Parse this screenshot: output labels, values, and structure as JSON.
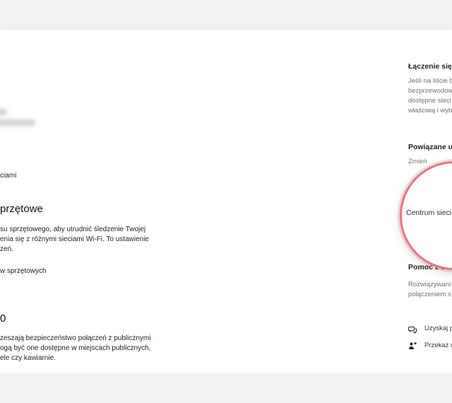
{
  "left": {
    "link_fragment": "ciami",
    "hardware_heading": "przętowe",
    "hardware_desc": "su sprzętowego, aby utrudnić śledzenie Twojej\nenia się z różnymi sieciami Wi-Fi. To ustawienie\nzeń.",
    "hardware_toggle_label": "w sprzętowych",
    "zero_heading": "0",
    "security_desc": "zeszają bezpieczeństwo połączeń z publicznymi\nogą być one dostępne w miejscach publicznych,\nele czy kawiarnie."
  },
  "right": {
    "connect_heading": "Łączenie się z",
    "connect_desc": "Jeśli na liście b\nbezprzewodow\ndostępne sieci\nwłaściwą i wyb",
    "related_heading": "Powiązane ust",
    "change_link": "Zmień",
    "network_center_link": "Centrum sieci",
    "help_heading": "Pomoc z sieci",
    "help_desc": "Rozwiązywani\npołączeniem s",
    "get_help": "Uzyskaj p",
    "feedback": "Przekaż o"
  },
  "colors": {
    "magnifier_ring": "#e07887",
    "panel_bg": "#ffffff",
    "page_bg": "#f2f2f2"
  },
  "icons": {
    "get_help": "chat-help-icon",
    "feedback": "feedback-person-icon"
  }
}
